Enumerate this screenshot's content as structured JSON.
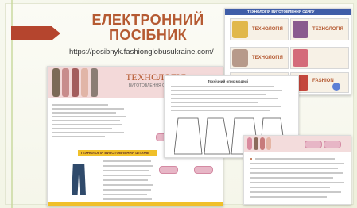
{
  "slide": {
    "title_line1": "ЕЛЕКТРОННИЙ",
    "title_line2": "ПОСІБНИК",
    "url": "https://posibnyk.fashionglobusukraine.com/"
  },
  "docs": {
    "main": {
      "banner_title_line1": "ТЕХНОЛОГІЯ",
      "banner_title_line2": "ВИГОТОВЛЕННЯ СПІДНИЦЬ",
      "section_heading": "ТЕХНОЛОГІЯ ВИГОТОВЛЕННЯ ШТАНІВ"
    },
    "top_right": {
      "header": "ТЕХНОЛОГІЯ ВИГОТОВЛЕННЯ ОДЯГУ",
      "card1_title": "ТЕХНОЛОГІЯ",
      "card2_title": "ТЕХНОЛОГІЯ",
      "card3_title": "ТЕХНОЛОГІЯ",
      "card4_title": "FASHION"
    },
    "middle": {
      "heading": "Технічний опис моделі"
    }
  },
  "colors": {
    "title": "#b55a32",
    "accent_arrow": "#b5452e",
    "yellow": "#f0c02a",
    "pink": "#e7b6c6",
    "navy": "#2f3e63"
  }
}
